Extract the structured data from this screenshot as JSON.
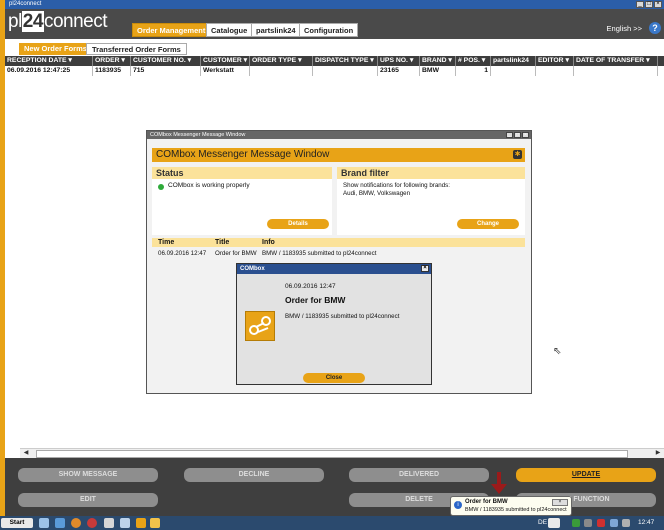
{
  "window": {
    "title": "pl24connect"
  },
  "logo": {
    "prefix": "pl",
    "num": "24",
    "suffix": "connect"
  },
  "nav": {
    "tabs": [
      "Order Management",
      "Catalogue",
      "partslink24",
      "Configuration"
    ],
    "active": "Order Management"
  },
  "header": {
    "language": "English >>",
    "help": "?"
  },
  "subtabs": [
    "New Order Forms",
    "Transferred Order Forms"
  ],
  "table": {
    "columns": [
      "RECEPTION DATE ▾",
      "ORDER ▾",
      "CUSTOMER NO. ▾",
      "CUSTOMER ▾",
      "ORDER TYPE ▾",
      "DISPATCH TYPE ▾",
      "UPS NO. ▾",
      "BRAND ▾",
      "# POS. ▾",
      "partslink24",
      "EDITOR ▾",
      "DATE OF TRANSFER ▾"
    ],
    "rows": [
      {
        "reception_date": "06.09.2016 12:47:25",
        "order": "1183935",
        "customer_no": "715",
        "customer": "Werkstatt",
        "order_type": "",
        "dispatch_type": "",
        "ups_no": "23165",
        "brand": "BMW",
        "pos": "1",
        "partslink": "",
        "editor": "",
        "transfer_date": ""
      }
    ]
  },
  "combox": {
    "window_title": "COMbox Messenger Message Window",
    "banner": "COMbox Messenger Message Window",
    "status": {
      "heading": "Status",
      "text": "COMbox is working properly",
      "button": "Details"
    },
    "brand_filter": {
      "heading": "Brand filter",
      "line1": "Show notifications for following brands:",
      "line2": "Audi, BMW, Volkswagen",
      "button": "Change"
    },
    "messages": {
      "headers": [
        "Time",
        "Title",
        "Info"
      ],
      "rows": [
        {
          "time": "06.09.2016 12:47",
          "title": "Order for BMW",
          "info": "BMW / 1183935 submitted to pl24connect"
        }
      ]
    },
    "popup": {
      "title": "COMbox",
      "date": "06.09.2016 12:47",
      "heading": "Order for BMW",
      "text": "BMW / 1183935 submitted to pl24connect",
      "button": "Close"
    }
  },
  "actions": {
    "show_message": "SHOW MESSAGE",
    "decline": "DECLINE",
    "delivered": "DELIVERED",
    "update": "UPDATE",
    "edit": "EDIT",
    "delete": "DELETE",
    "function": "TE FUNCTION"
  },
  "tooltip": {
    "title": "Order for BMW",
    "text": "BMW / 1183935 submitted to pl24connect"
  },
  "taskbar": {
    "start": "Start",
    "lang": "DE",
    "clock": "12:47"
  },
  "colors": {
    "accent": "#e8a317",
    "dark": "#3f3f3f",
    "titlebar": "#2b5ea8"
  }
}
